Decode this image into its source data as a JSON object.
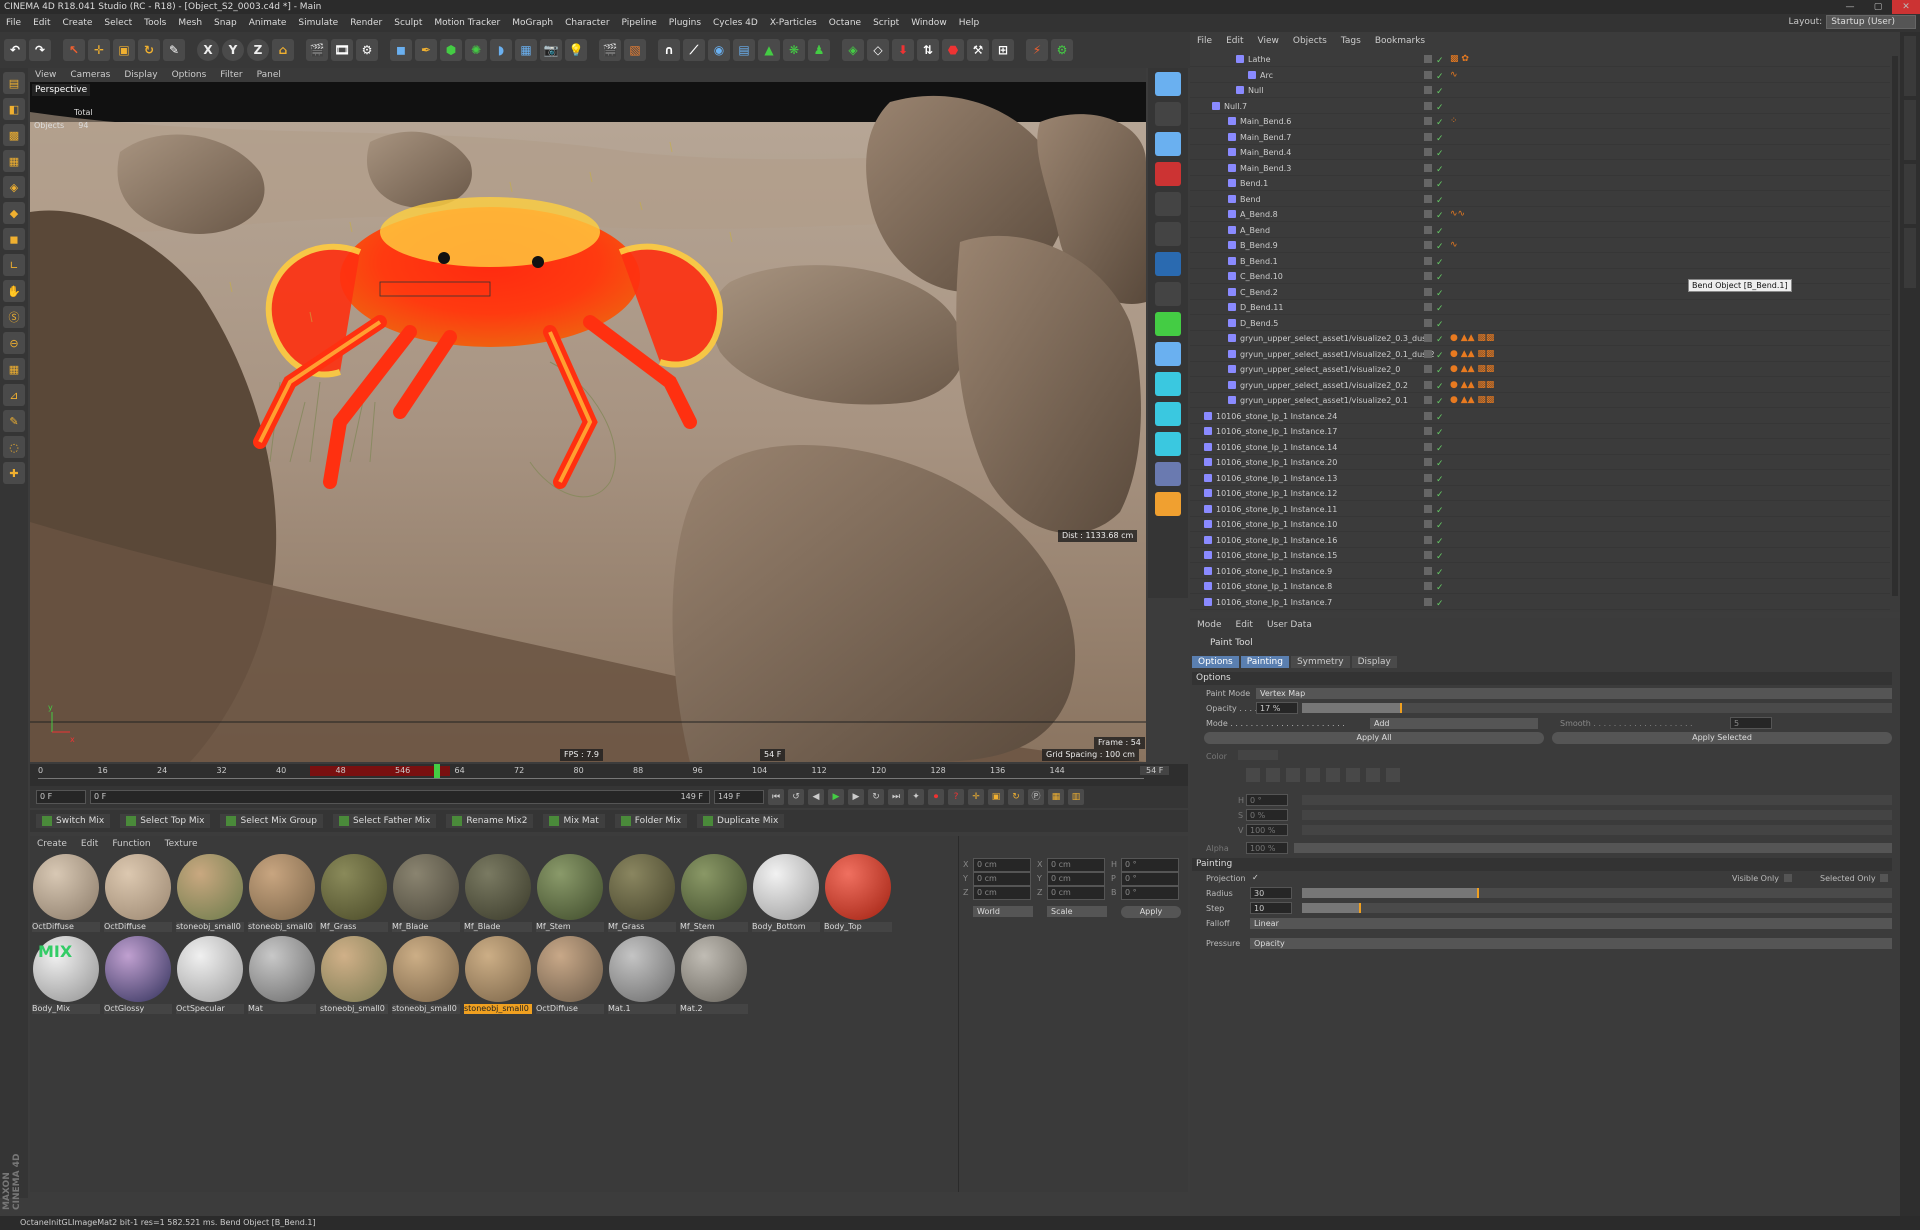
{
  "window": {
    "title": "CINEMA 4D R18.041 Studio (RC - R18) - [Object_S2_0003.c4d *] - Main"
  },
  "menu": [
    "File",
    "Edit",
    "Create",
    "Select",
    "Tools",
    "Mesh",
    "Snap",
    "Animate",
    "Simulate",
    "Render",
    "Sculpt",
    "Motion Tracker",
    "MoGraph",
    "Character",
    "Pipeline",
    "Plugins",
    "Cycles 4D",
    "X-Particles",
    "Octane",
    "Script",
    "Window",
    "Help"
  ],
  "layout": {
    "label": "Layout:",
    "value": "Startup (User)"
  },
  "toolbar": {
    "axes": [
      "X",
      "Y",
      "Z"
    ]
  },
  "viewport": {
    "menu": [
      "View",
      "Cameras",
      "Display",
      "Options",
      "Filter",
      "Panel"
    ],
    "label": "Perspective",
    "stats_total": "Total",
    "stats_objects_label": "Objects",
    "stats_objects_value": "94",
    "fps": "FPS : 7.9",
    "frame_center": "54 F",
    "dist": "Dist : 1133.68 cm",
    "frame": "Frame : 54",
    "grid": "Grid Spacing : 100 cm",
    "axis_y": "y",
    "axis_x": "x"
  },
  "timeline": {
    "ticks": [
      "0",
      "16",
      "24",
      "32",
      "40",
      "48",
      "546",
      "64",
      "72",
      "80",
      "88",
      "96",
      "104",
      "112",
      "120",
      "128",
      "136",
      "144"
    ],
    "end": "54 F"
  },
  "transport": {
    "start": "0 F",
    "current": "0 F",
    "range_end": "149 F",
    "end": "149 F"
  },
  "mixbar": [
    "Switch Mix",
    "Select Top Mix",
    "Select Mix Group",
    "Select Father Mix",
    "Rename Mix2",
    "Mix Mat",
    "Folder Mix",
    "Duplicate Mix"
  ],
  "materials": {
    "menu": [
      "Create",
      "Edit",
      "Function",
      "Texture"
    ],
    "row1": [
      {
        "name": "OctDiffuse",
        "c1": "#d8c8b4",
        "c2": "#8a7a68"
      },
      {
        "name": "OctDiffuse",
        "c1": "#dcc8b0",
        "c2": "#9a8670"
      },
      {
        "name": "stoneobj_small0",
        "c1": "#c9a880",
        "c2": "#6a7a4a"
      },
      {
        "name": "stoneobj_small0",
        "c1": "#c8a580",
        "c2": "#7a6448"
      },
      {
        "name": "Mf_Grass",
        "c1": "#8a8a5a",
        "c2": "#4a4a28"
      },
      {
        "name": "Mf_Blade",
        "c1": "#8a8470",
        "c2": "#4a463a"
      },
      {
        "name": "Mf_Blade",
        "c1": "#7a7a62",
        "c2": "#3a3a2a"
      },
      {
        "name": "Mf_Stem",
        "c1": "#8a9a6a",
        "c2": "#3e4a2a"
      },
      {
        "name": "Mf_Grass",
        "c1": "#8a8660",
        "c2": "#44422a"
      },
      {
        "name": "Mf_Stem",
        "c1": "#8a9866",
        "c2": "#3e4a2a"
      },
      {
        "name": "Body_Bottom",
        "c1": "#f2f2f2",
        "c2": "#9a9a9a"
      },
      {
        "name": "Body_Top",
        "c1": "#f07060",
        "c2": "#a02010"
      }
    ],
    "row2": [
      {
        "name": "Body_Mix",
        "c1": "#f0f0f0",
        "c2": "#909090",
        "mix": "MIX"
      },
      {
        "name": "OctGlossy",
        "c1": "#c0a0d0",
        "c2": "#30305a"
      },
      {
        "name": "OctSpecular",
        "c1": "#f0f0f0",
        "c2": "#9a9a9a"
      },
      {
        "name": "Mat",
        "c1": "#c8c8c8",
        "c2": "#6a6a6a"
      },
      {
        "name": "stoneobj_small0",
        "c1": "#d0b088",
        "c2": "#7a7a52"
      },
      {
        "name": "stoneobj_small0",
        "c1": "#ccae86",
        "c2": "#7a6448"
      },
      {
        "name": "stoneobj_small0",
        "c1": "#ccae86",
        "c2": "#7a6448",
        "highlight": true
      },
      {
        "name": "OctDiffuse",
        "c1": "#c8a888",
        "c2": "#6a5a48"
      },
      {
        "name": "Mat.1",
        "c1": "#c4c4c4",
        "c2": "#6a6a6a"
      },
      {
        "name": "Mat.2",
        "c1": "#c0bcb4",
        "c2": "#66625a"
      }
    ]
  },
  "coords": {
    "x": "X",
    "y": "Y",
    "z": "Z",
    "h": "H",
    "p": "P",
    "b": "B",
    "val": "0 cm",
    "deg": "0 °",
    "world": "World",
    "scale": "Scale",
    "apply": "Apply"
  },
  "objects": {
    "menu": [
      "File",
      "Edit",
      "View",
      "Objects",
      "Tags",
      "Bookmarks"
    ],
    "rows": [
      {
        "name": "Lathe",
        "indent": 44,
        "tags": "▩ ✿"
      },
      {
        "name": "Arc",
        "indent": 56,
        "tags": "∿"
      },
      {
        "name": "Null",
        "indent": 44,
        "tags": ""
      },
      {
        "name": "Null.7",
        "indent": 20,
        "tags": ""
      },
      {
        "name": "Main_Bend.6",
        "indent": 36,
        "tags": "⁘"
      },
      {
        "name": "Main_Bend.7",
        "indent": 36,
        "tags": ""
      },
      {
        "name": "Main_Bend.4",
        "indent": 36,
        "tags": ""
      },
      {
        "name": "Main_Bend.3",
        "indent": 36,
        "tags": ""
      },
      {
        "name": "Bend.1",
        "indent": 36,
        "tags": ""
      },
      {
        "name": "Bend",
        "indent": 36,
        "tags": ""
      },
      {
        "name": "A_Bend.8",
        "indent": 36,
        "tags": "∿∿"
      },
      {
        "name": "A_Bend",
        "indent": 36,
        "tags": ""
      },
      {
        "name": "B_Bend.9",
        "indent": 36,
        "tags": "∿"
      },
      {
        "name": "B_Bend.1",
        "indent": 36,
        "tags": ""
      },
      {
        "name": "C_Bend.10",
        "indent": 36,
        "tags": ""
      },
      {
        "name": "C_Bend.2",
        "indent": 36,
        "tags": ""
      },
      {
        "name": "D_Bend.11",
        "indent": 36,
        "tags": ""
      },
      {
        "name": "D_Bend.5",
        "indent": 36,
        "tags": ""
      },
      {
        "name": "gryun_upper_select_asset1/visualize2_0.3_dust",
        "indent": 36,
        "tags": "● ▲▲ ▩▩"
      },
      {
        "name": "gryun_upper_select_asset1/visualize2_0.1_dust2",
        "indent": 36,
        "tags": "● ▲▲ ▩▩"
      },
      {
        "name": "gryun_upper_select_asset1/visualize2_0",
        "indent": 36,
        "tags": "● ▲▲ ▩▩"
      },
      {
        "name": "gryun_upper_select_asset1/visualize2_0.2",
        "indent": 36,
        "tags": "● ▲▲ ▩▩"
      },
      {
        "name": "gryun_upper_select_asset1/visualize2_0.1",
        "indent": 36,
        "tags": "● ▲▲ ▩▩"
      },
      {
        "name": "10106_stone_lp_1 Instance.24",
        "indent": 12,
        "tags": ""
      },
      {
        "name": "10106_stone_lp_1 Instance.17",
        "indent": 12,
        "tags": ""
      },
      {
        "name": "10106_stone_lp_1 Instance.14",
        "indent": 12,
        "tags": ""
      },
      {
        "name": "10106_stone_lp_1 Instance.20",
        "indent": 12,
        "tags": ""
      },
      {
        "name": "10106_stone_lp_1 Instance.13",
        "indent": 12,
        "tags": ""
      },
      {
        "name": "10106_stone_lp_1 Instance.12",
        "indent": 12,
        "tags": ""
      },
      {
        "name": "10106_stone_lp_1 Instance.11",
        "indent": 12,
        "tags": ""
      },
      {
        "name": "10106_stone_lp_1 Instance.10",
        "indent": 12,
        "tags": ""
      },
      {
        "name": "10106_stone_lp_1 Instance.16",
        "indent": 12,
        "tags": ""
      },
      {
        "name": "10106_stone_lp_1 Instance.15",
        "indent": 12,
        "tags": ""
      },
      {
        "name": "10106_stone_lp_1 Instance.9",
        "indent": 12,
        "tags": ""
      },
      {
        "name": "10106_stone_lp_1 Instance.8",
        "indent": 12,
        "tags": ""
      },
      {
        "name": "10106_stone_lp_1 Instance.7",
        "indent": 12,
        "tags": ""
      }
    ],
    "tooltip": "Bend Object [B_Bend.1]"
  },
  "attributes": {
    "menu": [
      "Mode",
      "Edit",
      "User Data"
    ],
    "title": "Paint Tool",
    "tabs": [
      "Options",
      "Painting",
      "Symmetry",
      "Display"
    ],
    "section_options": "Options",
    "paint_mode_label": "Paint Mode",
    "paint_mode": "Vertex Map",
    "opacity_label": "Opacity . . . .",
    "opacity": "17 %",
    "opacity_level": 0.17,
    "mode_label": "Mode . . . . . . . . . . . . . . . . . . . . . . .",
    "mode": "Add",
    "smooth_label": "Smooth . . . . . . . . . . . . . . . . . . . .",
    "smooth": "5",
    "apply_all": "Apply All",
    "apply_selected": "Apply Selected",
    "color_label": "Color",
    "h": "H",
    "h_val": "0 °",
    "s": "S",
    "s_val": "0 %",
    "v": "V",
    "v_val": "100 %",
    "alpha_label": "Alpha",
    "alpha": "100 %",
    "section_painting": "Painting",
    "projection_label": "Projection",
    "visible_only": "Visible Only",
    "selected_only": "Selected Only",
    "radius_label": "Radius",
    "radius": "30",
    "radius_level": 0.3,
    "step_label": "Step",
    "step": "10",
    "step_level": 0.1,
    "falloff_label": "Falloff",
    "falloff": "Linear",
    "pressure_label": "Pressure",
    "pressure": "Opacity"
  },
  "status": "OctaneInitGLImageMat2  bit-1 res=1  582.521 ms.    Bend Object [B_Bend.1]",
  "brand": "MAXON CINEMA 4D"
}
